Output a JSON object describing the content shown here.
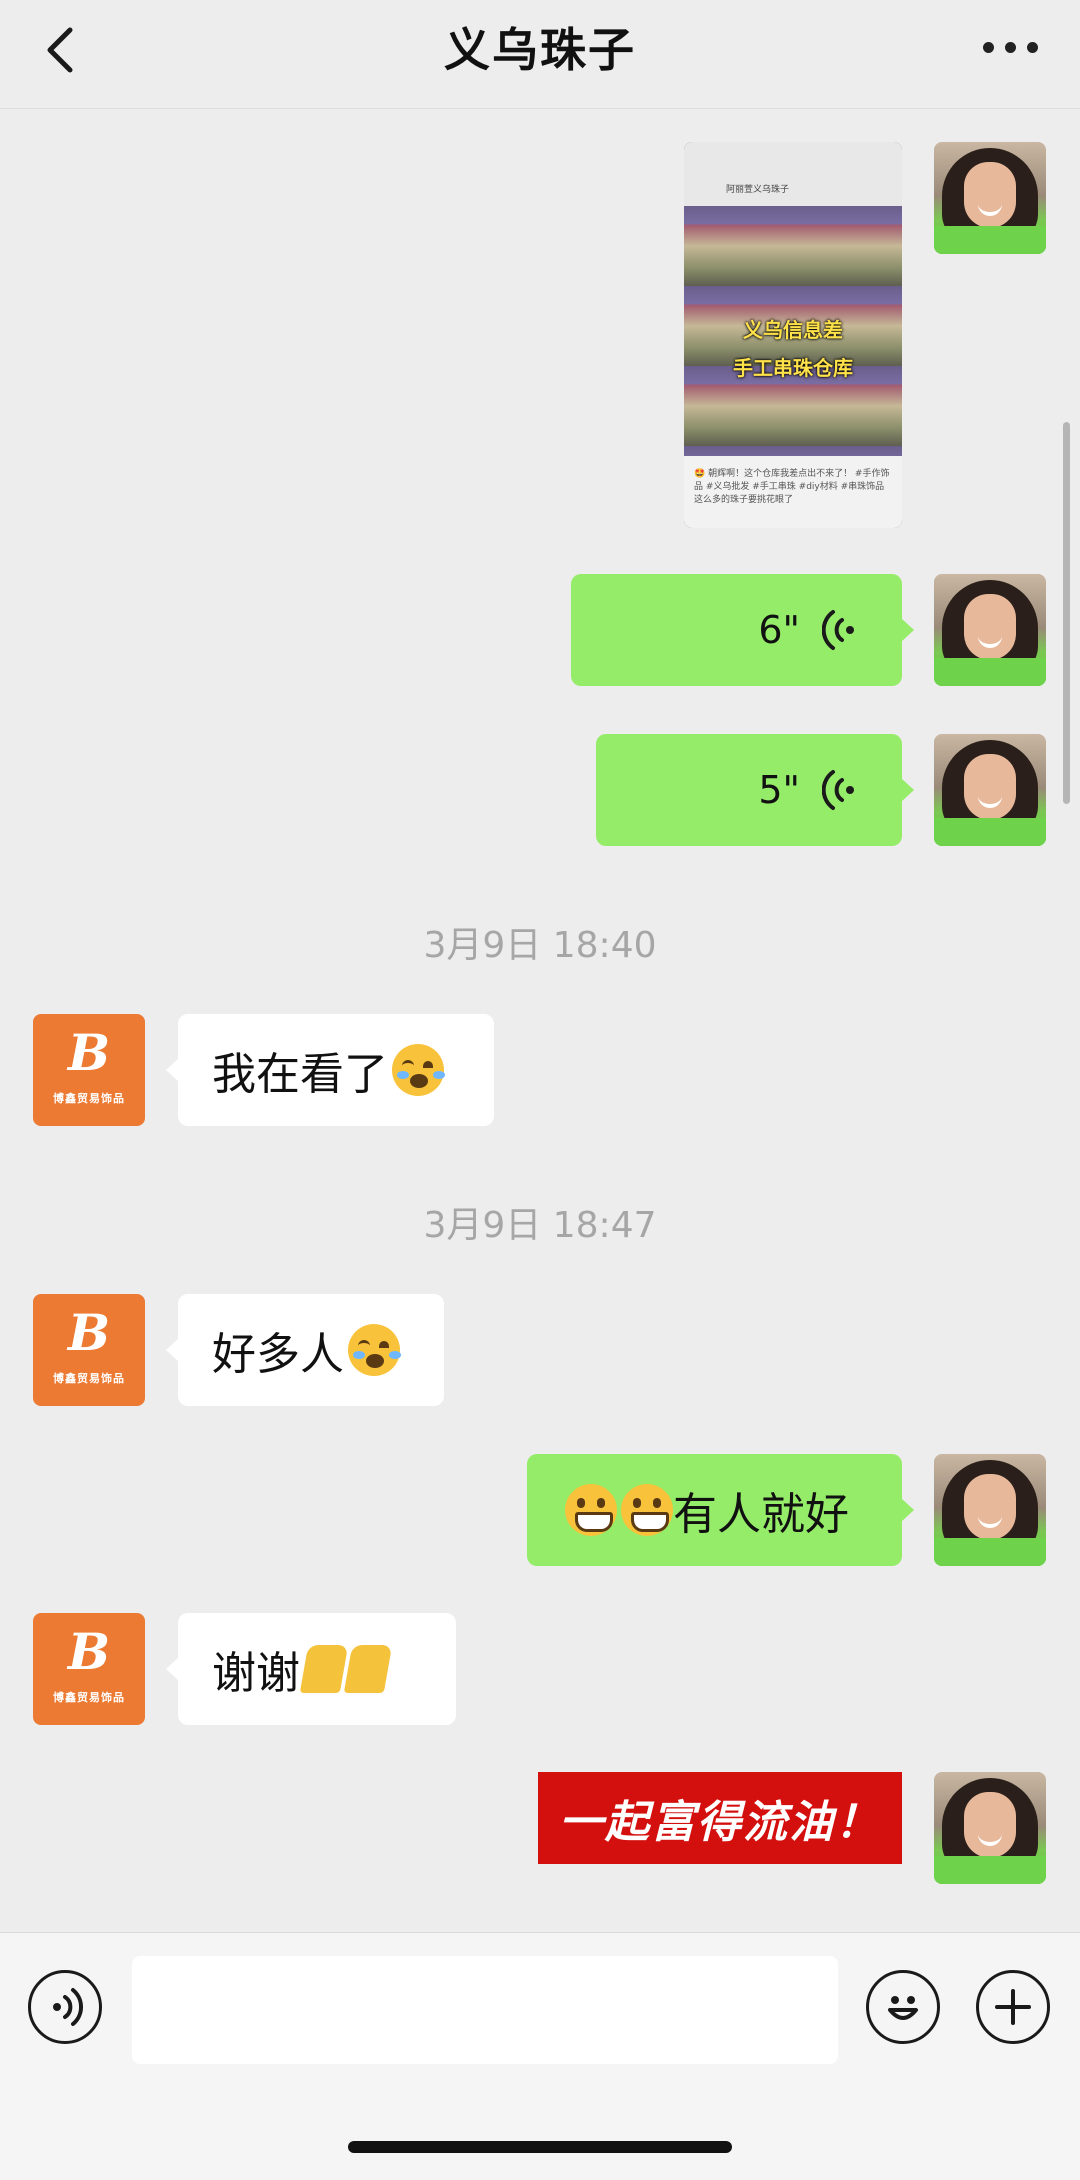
{
  "header": {
    "title": "义乌珠子",
    "back_icon": "chevron-left-icon",
    "more_icon": "more-dots-icon"
  },
  "shared_image": {
    "account": "阿丽萱义乌珠子",
    "caption_line1": "义乌信息差",
    "caption_line2": "手工串珠仓库",
    "post_text": "🤩 朝辉啊！这个仓库我差点出不来了！ #手作饰品 #义乌批发 #手工串珠 #diy材料 #串珠饰品 这么多的珠子要挑花眼了"
  },
  "voice_messages": [
    {
      "duration": "6\""
    },
    {
      "duration": "5\""
    }
  ],
  "timestamps": {
    "t1": "3月9日 18:40",
    "t2": "3月9日 18:47"
  },
  "messages": {
    "m1": {
      "text": "我在看了",
      "emoji": "crying-face"
    },
    "m2": {
      "text": "好多人",
      "emoji": "crying-face"
    },
    "m3": {
      "text": "有人就好",
      "emoji": "grinning-face"
    },
    "m4": {
      "text": "谢谢",
      "emoji": "folded-hands"
    }
  },
  "sticker": {
    "text": "一起富得流油！"
  },
  "contact_avatar": {
    "letter": "B",
    "brand": "博鑫贸易饰品"
  },
  "input_bar": {
    "placeholder": "",
    "icons": [
      "voice-icon",
      "emoji-icon",
      "plus-icon"
    ]
  },
  "colors": {
    "my_bubble": "#95ec69",
    "their_bubble": "#ffffff",
    "background": "#ededed",
    "avatar_brand": "#ec7a32",
    "sticker_red": "#d4100f"
  }
}
